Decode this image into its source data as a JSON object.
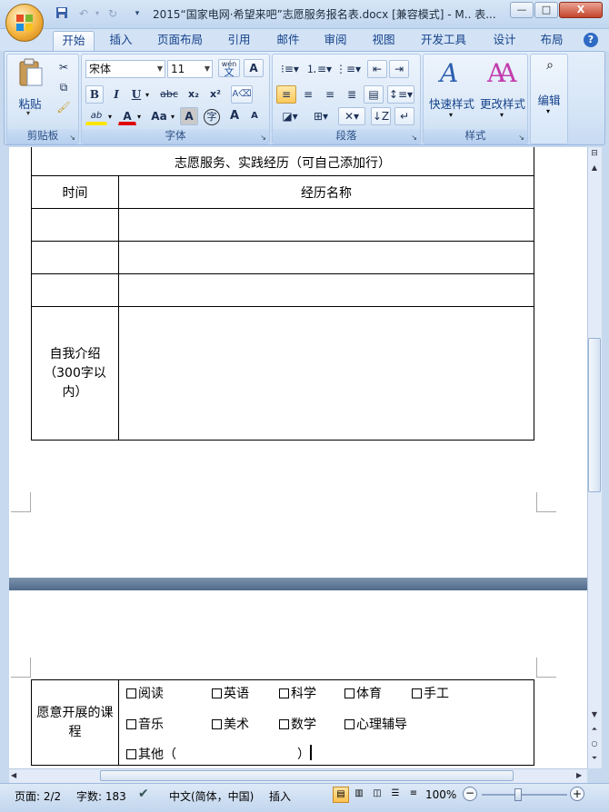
{
  "window": {
    "title": "2015“国家电网·希望来吧”志愿服务报名表.docx [兼容模式] - M.. 表...",
    "min_label": "—",
    "max_label": "□",
    "close_label": "X"
  },
  "quick_access": {
    "dropdown_label": "▾"
  },
  "tabs": [
    "开始",
    "插入",
    "页面布局",
    "引用",
    "邮件",
    "审阅",
    "视图",
    "开发工具",
    "设计",
    "布局"
  ],
  "help_label": "?",
  "ribbon": {
    "clipboard": {
      "label": "剪贴板",
      "paste_label": "粘贴"
    },
    "font": {
      "label": "字体",
      "font_name": "宋体",
      "font_size": "11",
      "wen_label": "wén",
      "wen_char": "文",
      "a_box": "A",
      "bold": "B",
      "italic": "I",
      "underline": "U",
      "strike": "abc",
      "sub": "x₂",
      "sup": "x²",
      "highlight": "ab",
      "font_color": "A",
      "case": "Aa",
      "shade": "A",
      "circle": "字",
      "grow": "A",
      "shrink": "A"
    },
    "paragraph": {
      "label": "段落"
    },
    "styles": {
      "label": "样式",
      "quick_styles": "快速样式",
      "change_styles": "更改样式"
    },
    "editing": {
      "label": "编辑",
      "find_icon_label": "🔍"
    }
  },
  "document": {
    "page1": {
      "section_header": "志愿服务、实践经历（可自己添加行）",
      "col_time": "时间",
      "col_name": "经历名称",
      "empty_rows": 3,
      "intro_label": "自我介绍（300字以内）"
    },
    "page2": {
      "willing_label": "愿意开展的课程",
      "options_row1": [
        "阅读",
        "英语",
        "科学",
        "体育",
        "手工"
      ],
      "options_row2": [
        "音乐",
        "美术",
        "数学",
        "心理辅导"
      ],
      "other_label": "其他（",
      "other_close": "）"
    }
  },
  "statusbar": {
    "page": "页面: 2/2",
    "words": "字数: 183",
    "language": "中文(简体，中国)",
    "insert_mode": "插入",
    "zoom": "100%"
  },
  "colors": {
    "ribbon_blue": "#d4e4f6",
    "label_blue": "#15428b",
    "accent_orange": "#f3b23c"
  }
}
